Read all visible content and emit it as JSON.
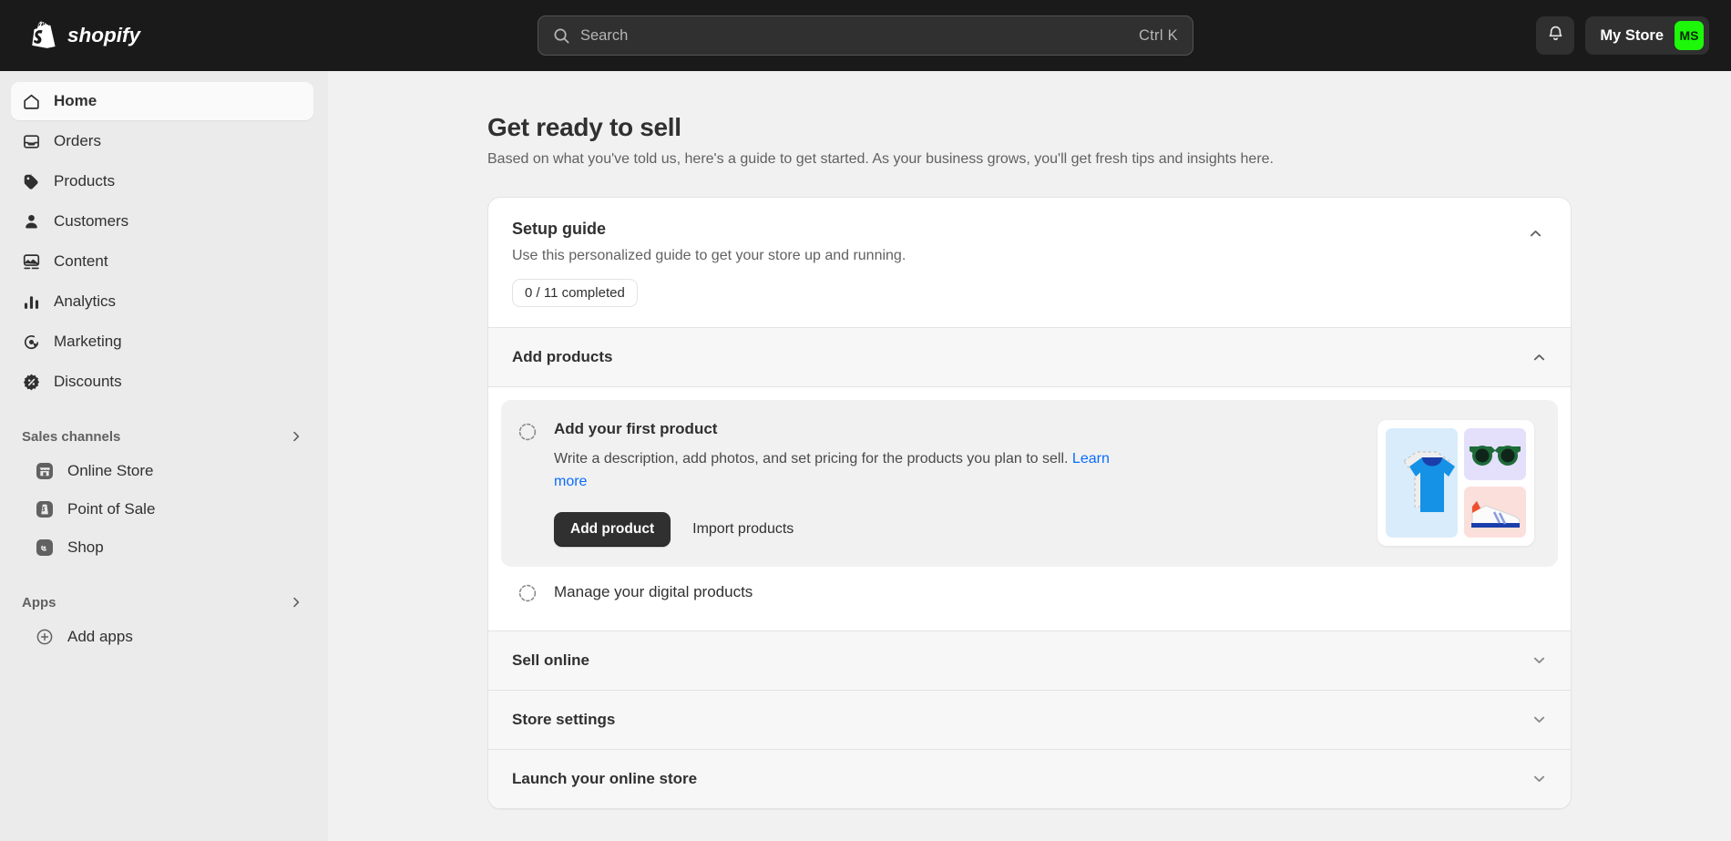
{
  "topbar": {
    "logo_text": "shopify",
    "logo_icon": "shopify-bag-icon",
    "search": {
      "placeholder": "Search",
      "shortcut": "Ctrl K",
      "icon": "search-icon"
    },
    "notifications_icon": "bell-icon",
    "store_name": "My Store",
    "store_initials": "MS",
    "avatar_color": "#1cf70a"
  },
  "sidebar": {
    "items": [
      {
        "label": "Home",
        "icon": "home-icon",
        "active": true
      },
      {
        "label": "Orders",
        "icon": "orders-inbox-icon",
        "active": false
      },
      {
        "label": "Products",
        "icon": "product-tag-icon",
        "active": false
      },
      {
        "label": "Customers",
        "icon": "person-icon",
        "active": false
      },
      {
        "label": "Content",
        "icon": "image-content-icon",
        "active": false
      },
      {
        "label": "Analytics",
        "icon": "bar-chart-icon",
        "active": false
      },
      {
        "label": "Marketing",
        "icon": "target-cursor-icon",
        "active": false
      },
      {
        "label": "Discounts",
        "icon": "discount-percent-icon",
        "active": false
      }
    ],
    "sections": [
      {
        "title": "Sales channels",
        "chevron_icon": "chevron-right-icon",
        "items": [
          {
            "label": "Online Store",
            "icon": "storefront-icon"
          },
          {
            "label": "Point of Sale",
            "icon": "point-of-sale-icon"
          },
          {
            "label": "Shop",
            "icon": "shop-icon"
          }
        ]
      },
      {
        "title": "Apps",
        "chevron_icon": "chevron-right-icon",
        "items": [
          {
            "label": "Add apps",
            "icon": "plus-circle-icon"
          }
        ]
      }
    ]
  },
  "main": {
    "title": "Get ready to sell",
    "subtitle": "Based on what you've told us, here's a guide to get started. As your business grows, you'll get fresh tips and insights here.",
    "setup_guide": {
      "title": "Setup guide",
      "description": "Use this personalized guide to get your store up and running.",
      "progress_pill": "0 / 11 completed",
      "collapse_icon": "chevron-up-icon"
    },
    "sections": [
      {
        "title": "Add products",
        "expanded": true,
        "chevron_icon": "chevron-up-icon",
        "tasks": [
          {
            "title": "Add your first product",
            "description_before_link": "Write a description, add photos, and set pricing for the products you plan to sell. ",
            "link_label": "Learn more",
            "primary_button": "Add product",
            "secondary_button": "Import products",
            "status_icon": "dashed-circle-icon",
            "illustration": "product-photos-illustration"
          },
          {
            "title": "Manage your digital products",
            "status_icon": "dashed-circle-icon"
          }
        ]
      },
      {
        "title": "Sell online",
        "expanded": false,
        "chevron_icon": "chevron-down-icon"
      },
      {
        "title": "Store settings",
        "expanded": false,
        "chevron_icon": "chevron-down-icon"
      },
      {
        "title": "Launch your online store",
        "expanded": false,
        "chevron_icon": "chevron-down-icon"
      }
    ]
  },
  "colors": {
    "topbar_bg": "#1a1a1a",
    "sidebar_bg": "#ebebeb",
    "content_bg": "#f1f1f1",
    "link": "#0a6cff",
    "primary_button": "#303030"
  }
}
